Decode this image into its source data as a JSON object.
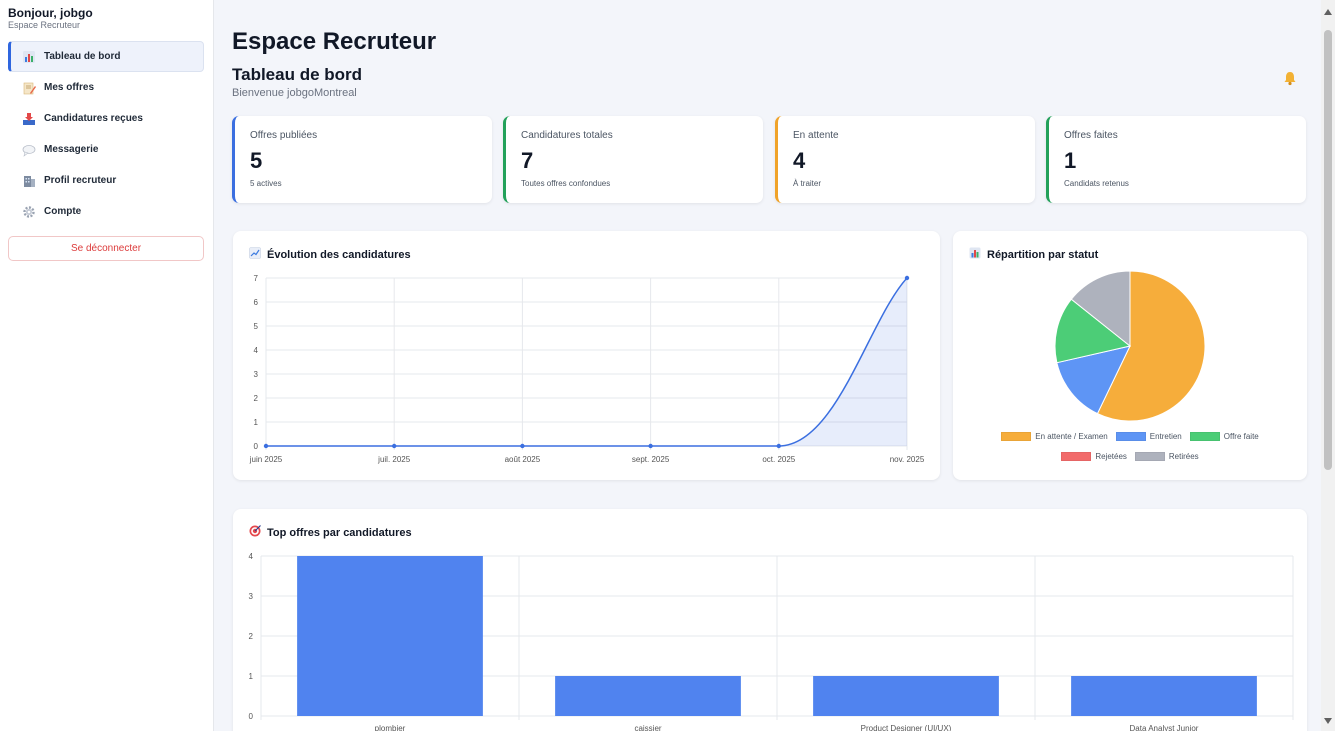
{
  "user": {
    "greeting": "Bonjour, jobgo",
    "role": "Espace Recruteur"
  },
  "sidebar": {
    "items": [
      {
        "label": "Tableau de bord",
        "icon": "bar-chart-icon",
        "active": true
      },
      {
        "label": "Mes offres",
        "icon": "memo-icon",
        "active": false
      },
      {
        "label": "Candidatures reçues",
        "icon": "inbox-icon",
        "active": false
      },
      {
        "label": "Messagerie",
        "icon": "speech-bubble-icon",
        "active": false
      },
      {
        "label": "Profil recruteur",
        "icon": "office-building-icon",
        "active": false
      },
      {
        "label": "Compte",
        "icon": "gear-icon",
        "active": false
      }
    ],
    "logout_label": "Se déconnecter"
  },
  "header": {
    "title": "Espace Recruteur",
    "subtitle": "Tableau de bord",
    "welcome": "Bienvenue jobgoMontreal",
    "bell_icon": "bell-icon"
  },
  "stats": [
    {
      "label": "Offres publiées",
      "value": "5",
      "note": "5 actives",
      "color": "#3b6fe0"
    },
    {
      "label": "Candidatures totales",
      "value": "7",
      "note": "Toutes offres confondues",
      "color": "#23a15a"
    },
    {
      "label": "En attente",
      "value": "4",
      "note": "À traiter",
      "color": "#f0a32a"
    },
    {
      "label": "Offres faites",
      "value": "1",
      "note": "Candidats retenus",
      "color": "#23a15a"
    }
  ],
  "evolution": {
    "title": "Évolution des candidatures",
    "icon": "chart-increasing-icon"
  },
  "repartition": {
    "title": "Répartition par statut",
    "icon": "bar-chart-icon"
  },
  "top_offres": {
    "title": "Top offres par candidatures",
    "icon": "direct-hit-icon"
  },
  "chart_data": [
    {
      "type": "line",
      "title": "Évolution des candidatures",
      "x": [
        "juin 2025",
        "juil. 2025",
        "août 2025",
        "sept. 2025",
        "oct. 2025",
        "nov. 2025"
      ],
      "series": [
        {
          "values": [
            0,
            0,
            0,
            0,
            0,
            7
          ],
          "color": "#3b6fe0"
        }
      ],
      "ylim": [
        0,
        7
      ],
      "yticks": [
        0,
        1,
        2,
        3,
        4,
        5,
        6,
        7
      ],
      "grid": true
    },
    {
      "type": "pie",
      "title": "Répartition par statut",
      "labels": [
        "En attente / Examen",
        "Entretien",
        "Offre faite",
        "Rejetées",
        "Retirées"
      ],
      "values": [
        4,
        1,
        1,
        0,
        1
      ],
      "colors": [
        "#f6ad3b",
        "#5e95f5",
        "#4ccd77",
        "#f26b6b",
        "#aeb2bd"
      ],
      "legend": "bottom"
    },
    {
      "type": "bar",
      "title": "Top offres par candidatures",
      "categories": [
        "plombier",
        "caissier",
        "Product Designer (UI/UX)",
        "Data Analyst Junior"
      ],
      "values": [
        4,
        1,
        1,
        1
      ],
      "color": "#5083ef",
      "ylim": [
        0,
        4
      ],
      "yticks": [
        0,
        1,
        2,
        3,
        4
      ],
      "grid": true
    }
  ]
}
